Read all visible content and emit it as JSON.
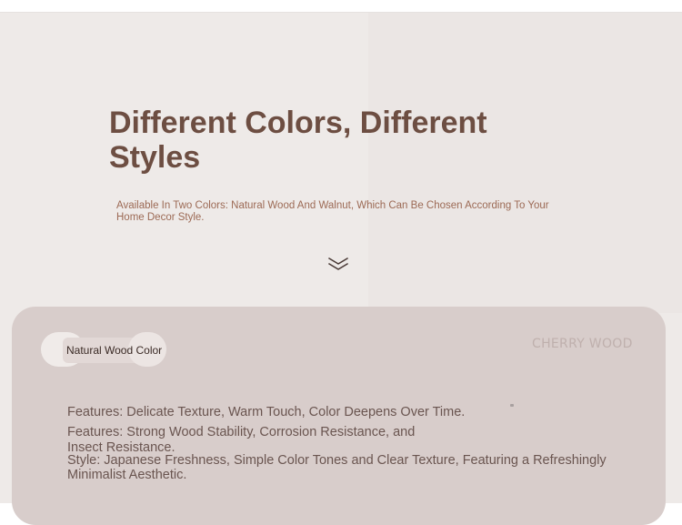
{
  "hero": {
    "title": "Different Colors, Different Styles",
    "subtitle": "Available In Two Colors: Natural Wood And Walnut, Which Can Be Chosen According To Your Home Decor Style."
  },
  "icons": {
    "scroll_down": "double-chevron-down-icon"
  },
  "colors": {
    "title": "#6d4e42",
    "subtitle": "#9c6a55",
    "panel": "#d8cdcb",
    "hero_background": "#eeeae8"
  },
  "options": {
    "selected": "Natural Wood Color",
    "alternate": "CHERRY WOOD"
  },
  "features": [
    "Features: Delicate Texture, Warm Touch, Color Deepens Over Time.",
    "Features: Strong Wood Stability, Corrosion Resistance, and Insect Resistance.",
    "Style: Japanese Freshness, Simple Color Tones and Clear Texture, Featuring a Refreshingly Minimalist Aesthetic."
  ]
}
